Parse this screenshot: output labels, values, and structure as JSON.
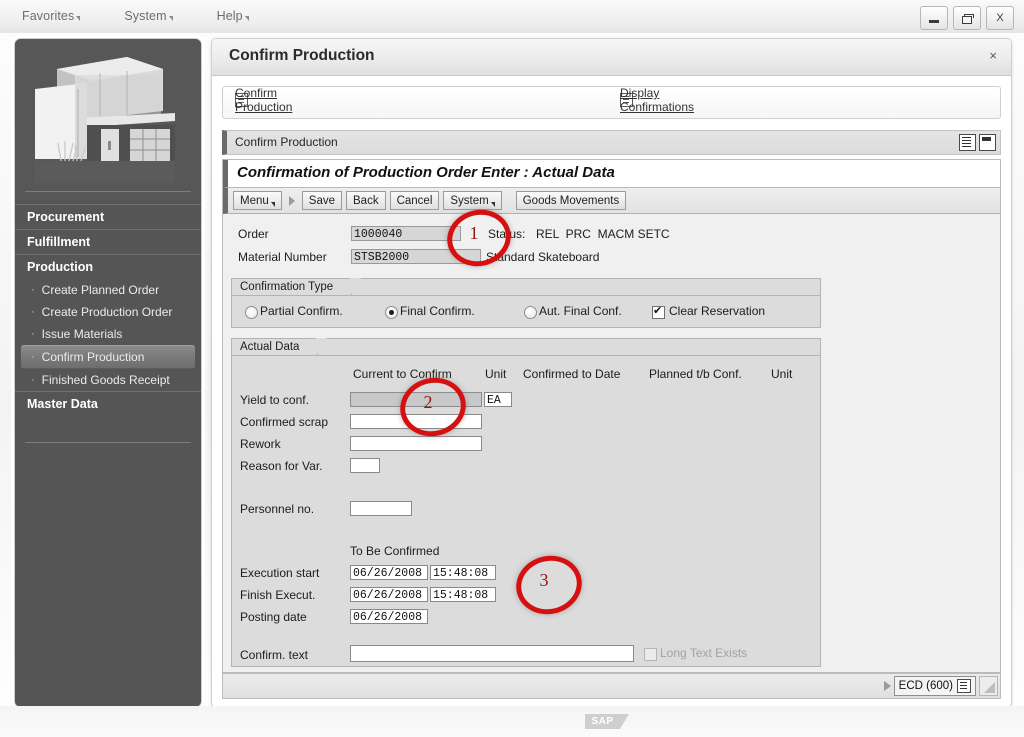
{
  "window": {
    "menus": [
      {
        "label": "Favorites"
      },
      {
        "label": "System"
      },
      {
        "label": "Help"
      }
    ],
    "controls": {
      "minimize": "—",
      "restore": "❐",
      "close": "X"
    }
  },
  "sidebar": {
    "image_alt": "factory-building-illustration",
    "items": [
      {
        "label": "Procurement",
        "type": "node",
        "selected": false
      },
      {
        "label": "Fulfillment",
        "type": "node",
        "selected": false
      },
      {
        "label": "Production",
        "type": "node",
        "selected": false
      },
      {
        "label": "Create Planned Order",
        "type": "leaf",
        "selected": false
      },
      {
        "label": "Create Production Order",
        "type": "leaf",
        "selected": false
      },
      {
        "label": "Issue Materials",
        "type": "leaf",
        "selected": false
      },
      {
        "label": "Confirm Production",
        "type": "leaf",
        "selected": true
      },
      {
        "label": "Finished Goods Receipt",
        "type": "leaf",
        "selected": false
      },
      {
        "label": "Master Data",
        "type": "node",
        "selected": false
      }
    ]
  },
  "main": {
    "title": "Confirm Production",
    "close": "×",
    "tabs": [
      {
        "label": "Confirm Production"
      },
      {
        "label": "Display Confirmations"
      }
    ],
    "panel_header": "Confirm Production",
    "screen_title": "Confirmation of Production Order Enter : Actual Data",
    "toolbar": [
      {
        "label": "Menu",
        "caret": true
      },
      {
        "label": "Save",
        "caret": false
      },
      {
        "label": "Back",
        "caret": false
      },
      {
        "label": "Cancel",
        "caret": false
      },
      {
        "label": "System",
        "caret": true
      },
      {
        "label": "Goods Movements",
        "caret": false
      }
    ],
    "header_fields": {
      "order_label": "Order",
      "order_value": "1000040",
      "status_label": "Status:",
      "status_value": "REL  PRC  MACM SETC",
      "material_label": "Material Number",
      "material_value": "STSB2000",
      "material_text": "Standard Skateboard"
    },
    "confirmation_type": {
      "group_label": "Confirmation Type",
      "options": [
        {
          "label": "Partial Confirm.",
          "selected": false
        },
        {
          "label": "Final Confirm.",
          "selected": true
        },
        {
          "label": "Aut. Final Conf.",
          "selected": false
        }
      ],
      "clear_reservation": {
        "label": "Clear Reservation",
        "checked": true
      }
    },
    "actual_data": {
      "group_label": "Actual Data",
      "columns": [
        "Current to Confirm",
        "Unit",
        "Confirmed to Date",
        "Planned t/b Conf.",
        "Unit"
      ],
      "rows": [
        {
          "label": "Yield to conf.",
          "value": "",
          "unit": "EA",
          "confirmed_to_date": "",
          "planned": "",
          "unit2": "",
          "focused": true
        },
        {
          "label": "Confirmed scrap",
          "value": "",
          "unit": "",
          "confirmed_to_date": "",
          "planned": "",
          "unit2": "",
          "focused": false
        },
        {
          "label": "Rework",
          "value": "",
          "unit": "",
          "confirmed_to_date": "",
          "planned": "",
          "unit2": "",
          "focused": false
        },
        {
          "label": "Reason for Var.",
          "value": "",
          "unit": "",
          "confirmed_to_date": "",
          "planned": "",
          "unit2": "",
          "focused": false
        }
      ],
      "personnel_label": "Personnel no.",
      "personnel_value": "",
      "to_be_confirmed_label": "To Be Confirmed",
      "time_rows": [
        {
          "label": "Execution start",
          "date": "06/26/2008",
          "time": "15:48:08"
        },
        {
          "label": "Finish Execut.",
          "date": "06/26/2008",
          "time": "15:48:08"
        },
        {
          "label": "Posting date",
          "date": "06/26/2008",
          "time": null
        }
      ],
      "confirm_text_label": "Confirm. text",
      "confirm_text_value": "",
      "long_text": {
        "label": "Long Text Exists",
        "checked": false,
        "disabled": true
      }
    },
    "statusbar": {
      "system": "ECD (600)"
    }
  },
  "annotations": [
    {
      "number": "1"
    },
    {
      "number": "2"
    },
    {
      "number": "3"
    }
  ],
  "branding": {
    "logo": "SAP"
  }
}
